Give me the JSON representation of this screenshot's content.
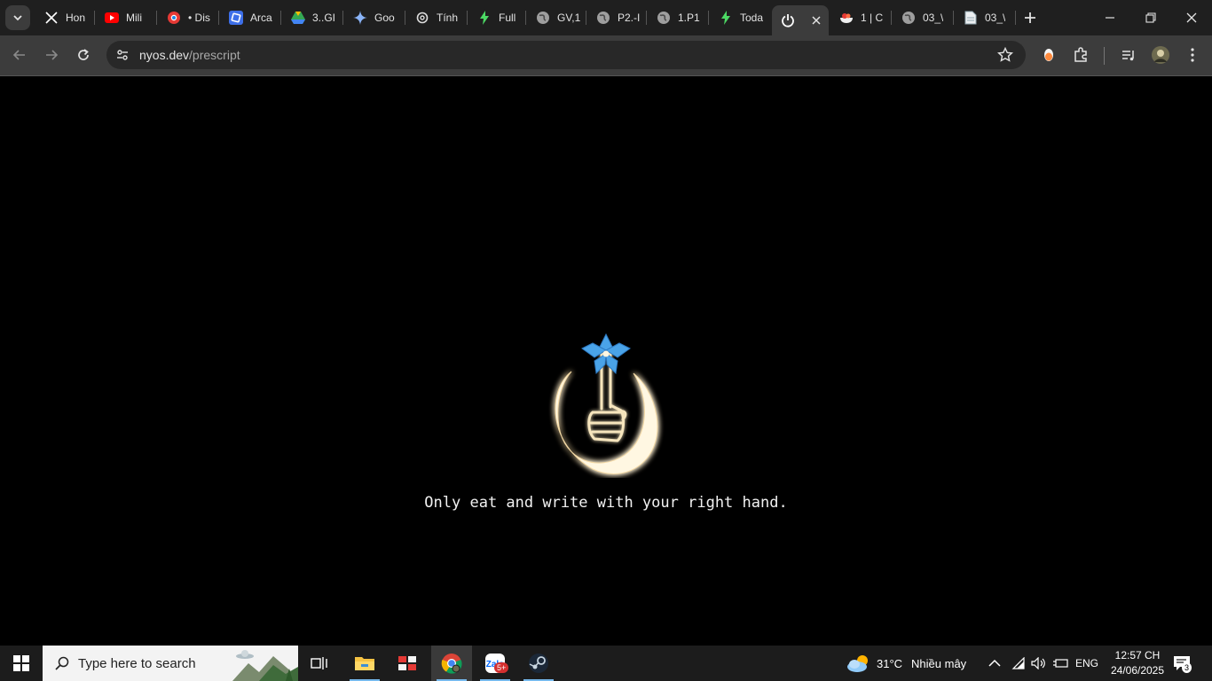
{
  "tabs": [
    {
      "title": "Hon",
      "icon": "x-logo-icon"
    },
    {
      "title": "Mili",
      "icon": "youtube-icon"
    },
    {
      "title": "• Dis",
      "icon": "chrome-red-icon"
    },
    {
      "title": "Arca",
      "icon": "arc-icon"
    },
    {
      "title": "3..GI",
      "icon": "drive-icon"
    },
    {
      "title": "Goo",
      "icon": "gemini-icon"
    },
    {
      "title": "Tính",
      "icon": "openai-icon"
    },
    {
      "title": "Full",
      "icon": "bolt-icon"
    },
    {
      "title": "GV,1",
      "icon": "globe-icon"
    },
    {
      "title": "P2.-I",
      "icon": "globe-icon"
    },
    {
      "title": "1.P1",
      "icon": "globe-icon"
    },
    {
      "title": "Toda",
      "icon": "bolt-icon"
    },
    {
      "title": "",
      "icon": "power-icon",
      "active": true
    },
    {
      "title": "1 | C",
      "icon": "bowl-icon"
    },
    {
      "title": "03_\\",
      "icon": "globe-icon"
    },
    {
      "title": "03_\\",
      "icon": "doc-icon"
    }
  ],
  "address": {
    "host": "nyos.dev",
    "path": "/prescript"
  },
  "page": {
    "caption": "Only eat and write with your right hand."
  },
  "taskbar": {
    "search_placeholder": "Type here to search",
    "zalo_badge": "5+",
    "weather_temp": "31°C",
    "weather_desc": "Nhiều mây",
    "lang": "ENG",
    "time": "12:57 CH",
    "date": "24/06/2025",
    "notif_count": "3"
  },
  "colors": {
    "accent_blue": "#4aa3e8",
    "glow_gold": "#f4d9a4"
  }
}
